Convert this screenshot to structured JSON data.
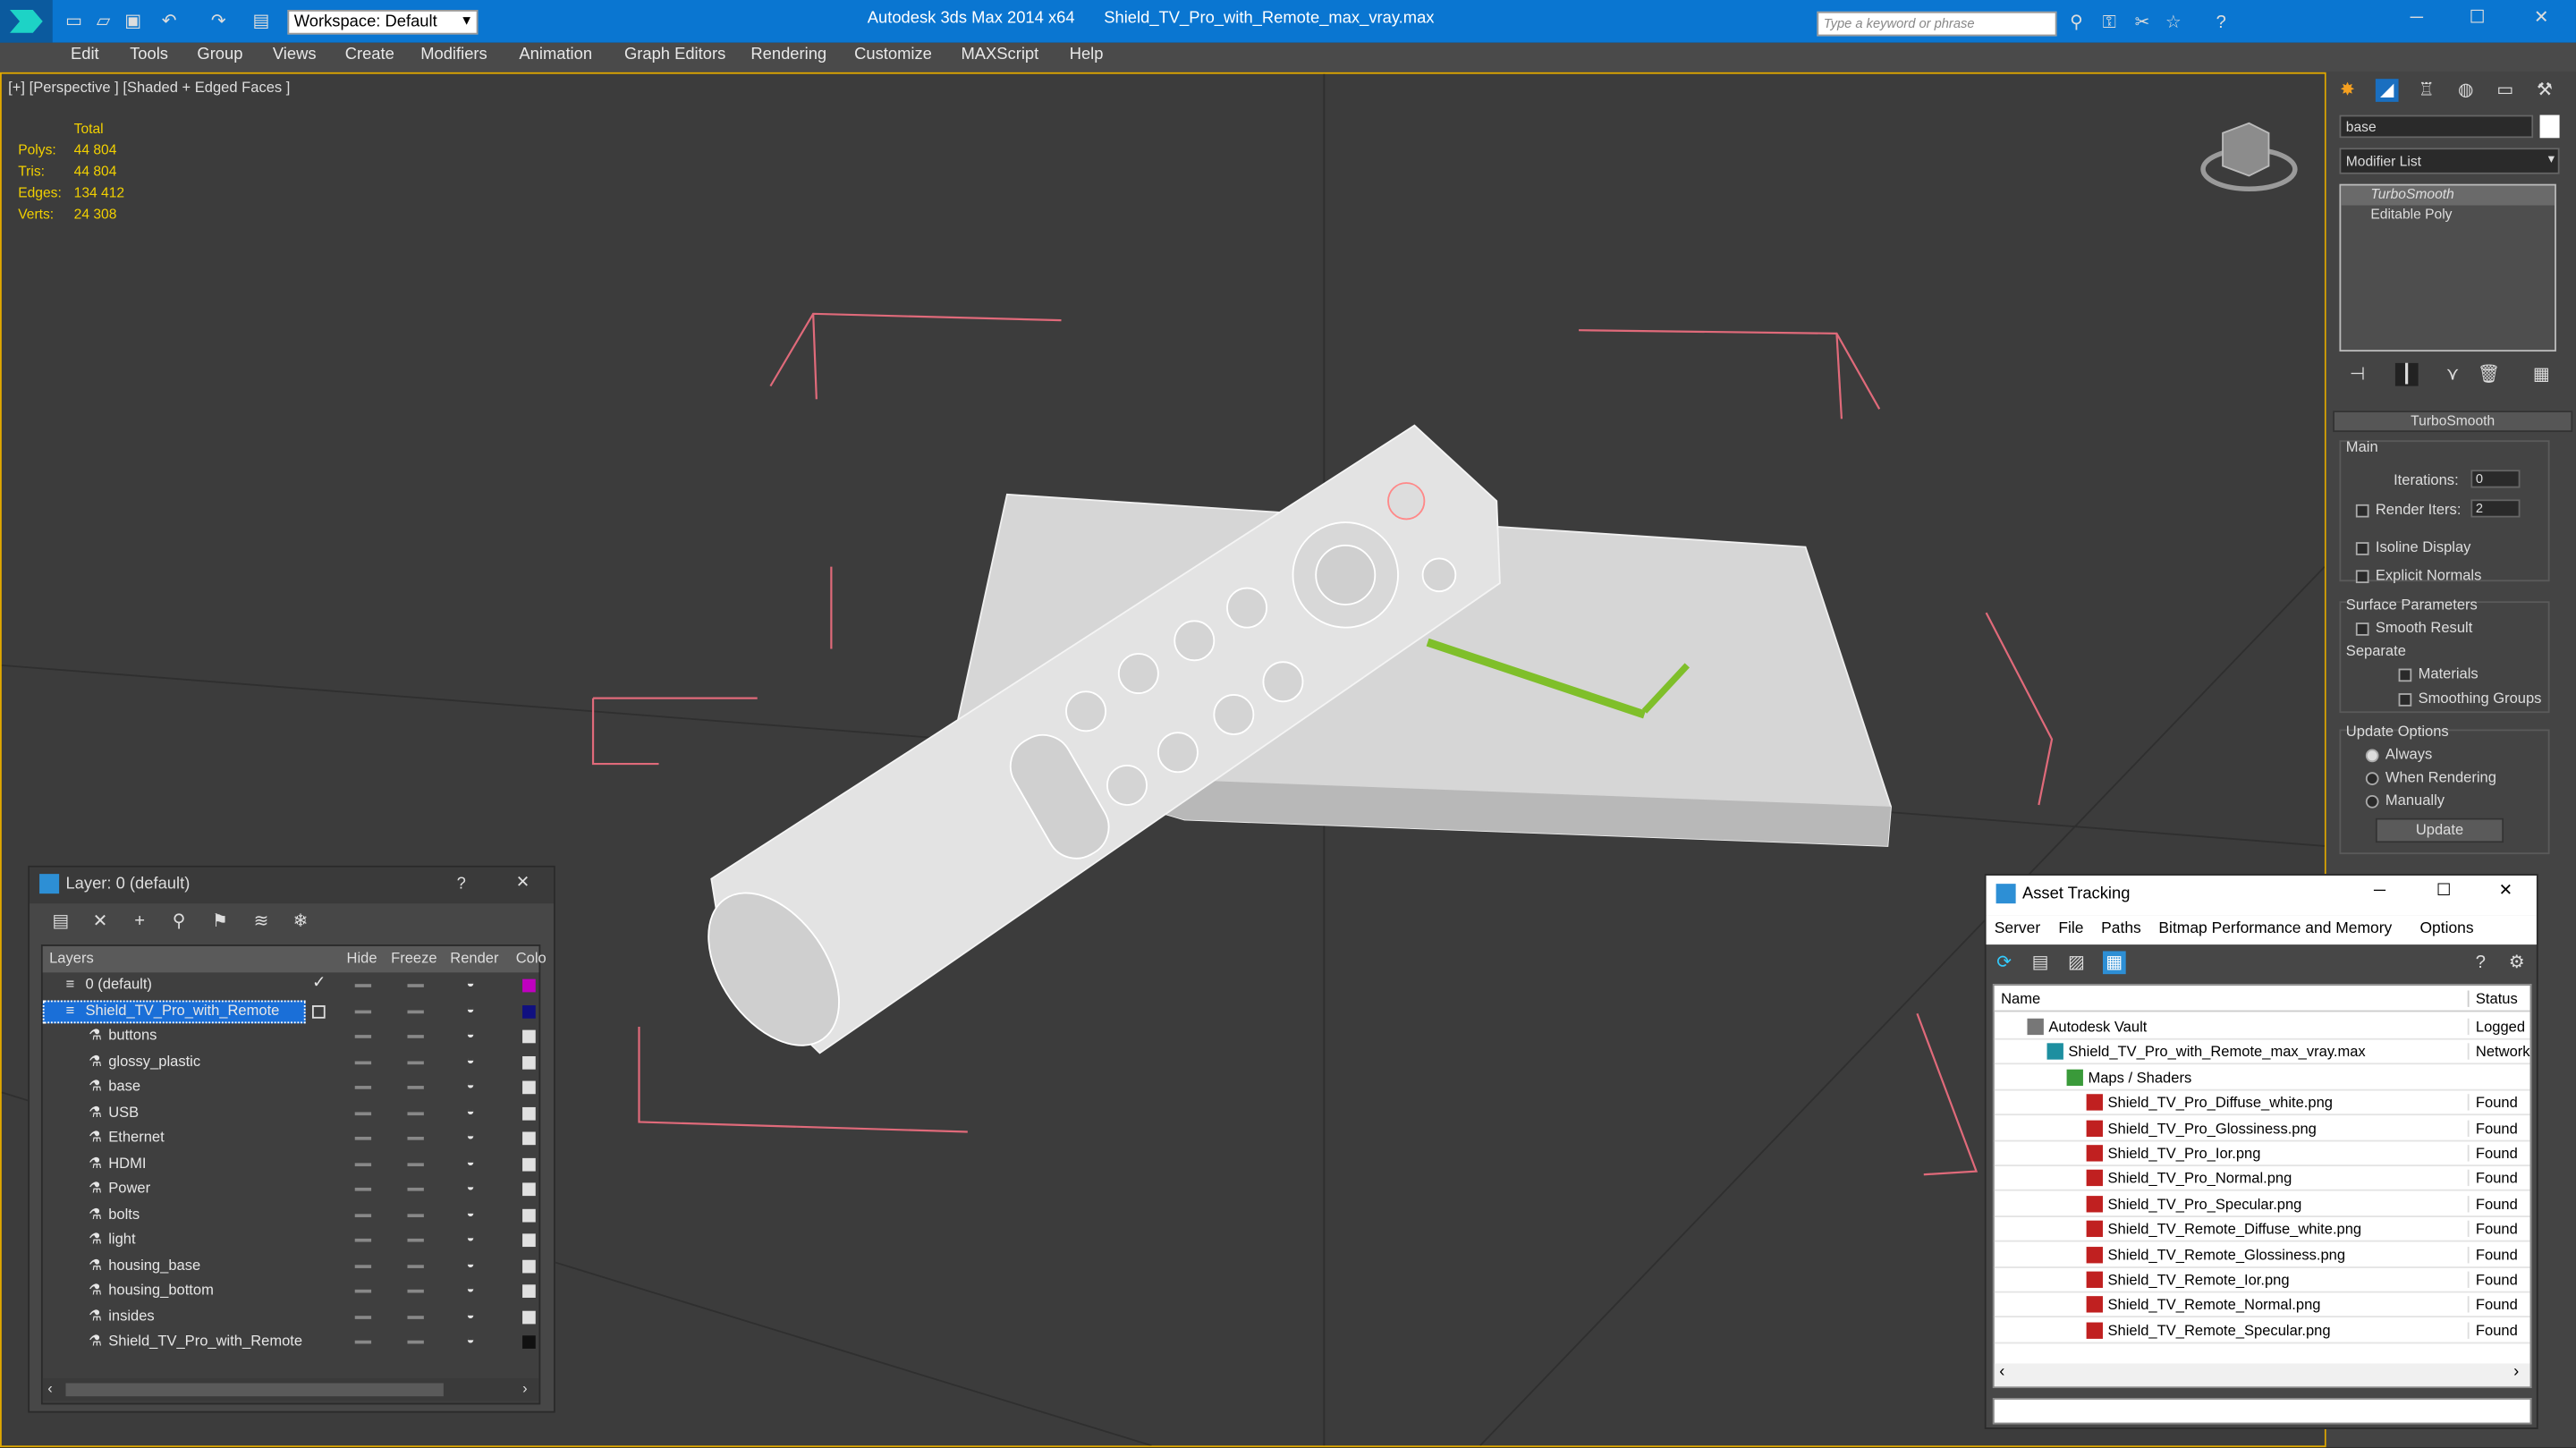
{
  "title_bar": {
    "workspace_label": "Workspace: Default",
    "app_title": "Autodesk 3ds Max  2014 x64",
    "file_title": "Shield_TV_Pro_with_Remote_max_vray.max",
    "search_placeholder": "Type a keyword or phrase"
  },
  "menu": [
    "Edit",
    "Tools",
    "Group",
    "Views",
    "Create",
    "Modifiers",
    "Animation",
    "Graph Editors",
    "Rendering",
    "Customize",
    "MAXScript",
    "Help"
  ],
  "viewport": {
    "label": "[+] [Perspective ] [Shaded + Edged Faces ]",
    "stats": {
      "header": "Total",
      "rows": [
        {
          "k": "Polys:",
          "v": "44 804"
        },
        {
          "k": "Tris:",
          "v": "44 804"
        },
        {
          "k": "Edges:",
          "v": "134 412"
        },
        {
          "k": "Verts:",
          "v": "24 308"
        }
      ]
    }
  },
  "command_panel": {
    "object_name": "base",
    "modifier_list": "Modifier List",
    "stack": [
      "TurboSmooth",
      "Editable Poly"
    ],
    "rollout_title": "TurboSmooth",
    "main_label": "Main",
    "iterations_label": "Iterations:",
    "iterations_value": "0",
    "render_iters_label": "Render Iters:",
    "render_iters_value": "2",
    "isoline": "Isoline Display",
    "explicit": "Explicit Normals",
    "surface_params": "Surface Parameters",
    "smooth_result": "Smooth Result",
    "separate": "Separate",
    "materials": "Materials",
    "smoothing_groups": "Smoothing Groups",
    "update_options": "Update Options",
    "always": "Always",
    "when_rendering": "When Rendering",
    "manually": "Manually",
    "update_button": "Update"
  },
  "layer_window": {
    "title": "Layer: 0 (default)",
    "help": "?",
    "columns": [
      "Layers",
      "Hide",
      "Freeze",
      "Render",
      "Colo"
    ],
    "rows": [
      {
        "name": "0 (default)",
        "level": 0,
        "color": "#c000c0"
      },
      {
        "name": "Shield_TV_Pro_with_Remote",
        "level": 0,
        "color": "#101080",
        "selected": true
      },
      {
        "name": "buttons",
        "level": 1,
        "color": "#e0e0e0"
      },
      {
        "name": "glossy_plastic",
        "level": 1,
        "color": "#e0e0e0"
      },
      {
        "name": "base",
        "level": 1,
        "color": "#e0e0e0"
      },
      {
        "name": "USB",
        "level": 1,
        "color": "#e0e0e0"
      },
      {
        "name": "Ethernet",
        "level": 1,
        "color": "#e0e0e0"
      },
      {
        "name": "HDMI",
        "level": 1,
        "color": "#e0e0e0"
      },
      {
        "name": "Power",
        "level": 1,
        "color": "#e0e0e0"
      },
      {
        "name": "bolts",
        "level": 1,
        "color": "#e0e0e0"
      },
      {
        "name": "light",
        "level": 1,
        "color": "#e0e0e0"
      },
      {
        "name": "housing_base",
        "level": 1,
        "color": "#e0e0e0"
      },
      {
        "name": "housing_bottom",
        "level": 1,
        "color": "#e0e0e0"
      },
      {
        "name": "insides",
        "level": 1,
        "color": "#e0e0e0"
      },
      {
        "name": "Shield_TV_Pro_with_Remote",
        "level": 1,
        "color": "#111111"
      }
    ]
  },
  "asset_window": {
    "title": "Asset Tracking",
    "menu": [
      "Server",
      "File",
      "Paths",
      "Bitmap Performance and Memory",
      "Options"
    ],
    "columns": [
      "Name",
      "Status"
    ],
    "rows": [
      {
        "name": "Autodesk Vault",
        "level": 0,
        "status": "Logged C"
      },
      {
        "name": "Shield_TV_Pro_with_Remote_max_vray.max",
        "level": 1,
        "status": "Network"
      },
      {
        "name": "Maps / Shaders",
        "level": 2,
        "status": ""
      },
      {
        "name": "Shield_TV_Pro_Diffuse_white.png",
        "level": 3,
        "status": "Found"
      },
      {
        "name": "Shield_TV_Pro_Glossiness.png",
        "level": 3,
        "status": "Found"
      },
      {
        "name": "Shield_TV_Pro_Ior.png",
        "level": 3,
        "status": "Found"
      },
      {
        "name": "Shield_TV_Pro_Normal.png",
        "level": 3,
        "status": "Found"
      },
      {
        "name": "Shield_TV_Pro_Specular.png",
        "level": 3,
        "status": "Found"
      },
      {
        "name": "Shield_TV_Remote_Diffuse_white.png",
        "level": 3,
        "status": "Found"
      },
      {
        "name": "Shield_TV_Remote_Glossiness.png",
        "level": 3,
        "status": "Found"
      },
      {
        "name": "Shield_TV_Remote_Ior.png",
        "level": 3,
        "status": "Found"
      },
      {
        "name": "Shield_TV_Remote_Normal.png",
        "level": 3,
        "status": "Found"
      },
      {
        "name": "Shield_TV_Remote_Specular.png",
        "level": 3,
        "status": "Found"
      }
    ]
  }
}
